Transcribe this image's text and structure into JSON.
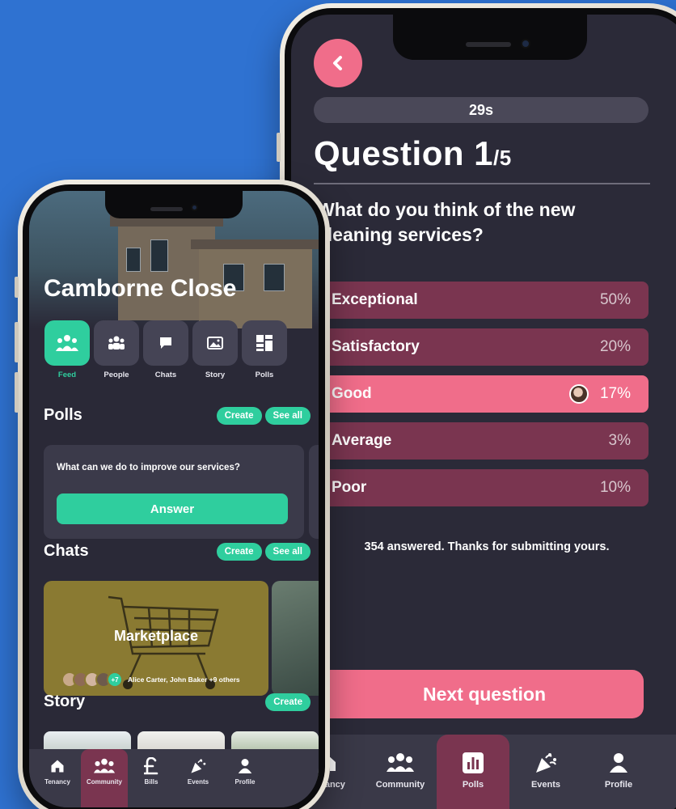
{
  "poll_screen": {
    "timer": "29s",
    "question_number": "Question 1",
    "question_total": "/5",
    "question_text": "What do you think of the new cleaning services?",
    "options": [
      {
        "label": "Exceptional",
        "percent": "50%",
        "selected": false
      },
      {
        "label": "Satisfactory",
        "percent": "20%",
        "selected": false
      },
      {
        "label": "Good",
        "percent": "17%",
        "selected": true
      },
      {
        "label": "Average",
        "percent": "3%",
        "selected": false
      },
      {
        "label": "Poor",
        "percent": "10%",
        "selected": false
      }
    ],
    "answered_text": "354 answered. Thanks for submitting yours.",
    "next_button": "Next question",
    "tabs": [
      {
        "label": "Tenancy",
        "icon": "home-icon"
      },
      {
        "label": "Community",
        "icon": "community-icon"
      },
      {
        "label": "Polls",
        "icon": "polls-icon",
        "active": true
      },
      {
        "label": "Events",
        "icon": "party-popper-icon"
      },
      {
        "label": "Profile",
        "icon": "profile-icon"
      }
    ]
  },
  "community_screen": {
    "title": "Camborne Close",
    "nav": [
      {
        "label": "Feed",
        "icon": "feed-icon",
        "active": true
      },
      {
        "label": "People",
        "icon": "people-icon"
      },
      {
        "label": "Chats",
        "icon": "chat-icon"
      },
      {
        "label": "Story",
        "icon": "image-icon"
      },
      {
        "label": "Polls",
        "icon": "polls-grid-icon"
      }
    ],
    "polls": {
      "heading": "Polls",
      "create": "Create",
      "see_all": "See all",
      "question": "What can we do to improve our services?",
      "answer_button": "Answer"
    },
    "chats": {
      "heading": "Chats",
      "create": "Create",
      "see_all": "See all",
      "card_title": "Marketplace",
      "extra_count": "+7",
      "members": "Alice Carter, John Baker +9 others"
    },
    "story": {
      "heading": "Story",
      "create": "Create"
    },
    "tabs": [
      {
        "label": "Tenancy",
        "icon": "home-icon"
      },
      {
        "label": "Community",
        "icon": "community-icon",
        "active": true
      },
      {
        "label": "Bills",
        "icon": "pound-icon"
      },
      {
        "label": "Events",
        "icon": "party-popper-icon"
      },
      {
        "label": "Profile",
        "icon": "profile-icon"
      }
    ]
  },
  "colors": {
    "background": "#2f72d1",
    "screen": "#2a2937",
    "accent_pink": "#f06d8a",
    "accent_green": "#2fce9e",
    "option_dim": "#7a3550"
  }
}
